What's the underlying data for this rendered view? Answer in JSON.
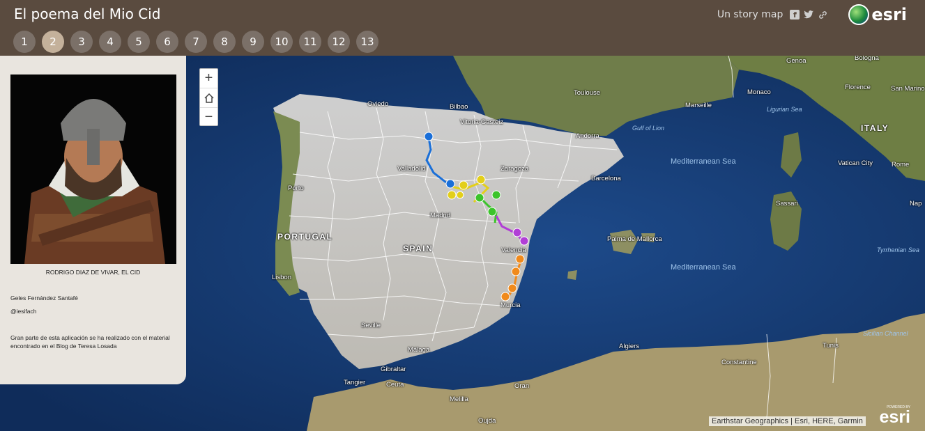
{
  "app": {
    "title": "El poema del Mio Cid"
  },
  "tabs": [
    "1",
    "2",
    "3",
    "4",
    "5",
    "6",
    "7",
    "8",
    "9",
    "10",
    "11",
    "12",
    "13"
  ],
  "active_tab": "2",
  "header": {
    "story_map_label": "Un story map",
    "brand": "esri"
  },
  "sidebar": {
    "caption": "RODRIGO DIAZ DE VIVAR, EL CID",
    "author": "Geles Fernández Santafé",
    "handle": "@iesifach",
    "credit": "Gran parte de esta aplicación se ha realizado con el material encontrado en el Blog de Teresa Losada"
  },
  "map": {
    "zoom_in": "+",
    "zoom_out": "−",
    "attribution": "Earthstar Geographics | Esri, HERE, Garmin",
    "powered_by": "POWERED BY",
    "powered_brand": "esri",
    "countries": [
      "PORTUGAL",
      "SPAIN",
      "ITALY"
    ],
    "seas": [
      "Mediterranean Sea",
      "Mediterranean Sea"
    ],
    "sea_features": [
      "Gulf of Lion",
      "Ligurian Sea",
      "Tyrrhenian Sea",
      "Sicilian Channel"
    ],
    "cities": [
      "Oviedo",
      "Bilbao",
      "Vitoria-Gasteiz",
      "Valladolid",
      "Zaragoza",
      "Barcelona",
      "Andorra",
      "Madrid",
      "Valencia",
      "Murcia",
      "Porto",
      "Lisbon",
      "Seville",
      "Málaga",
      "Gibraltar",
      "Tangier",
      "Ceuta",
      "Oran",
      "Melilla",
      "Oujda",
      "Algiers",
      "Constantine",
      "Tunis",
      "Toulouse",
      "Marseille",
      "Genoa",
      "Monaco",
      "Bologna",
      "Florence",
      "San Marino",
      "Vatican City",
      "Rome",
      "Sassari",
      "Palma de Mallorca",
      "Nap"
    ],
    "route_colors": {
      "blue": "#1a6fd8",
      "yellow": "#e3cf1a",
      "green": "#3cc42b",
      "purple": "#b13ed6",
      "orange": "#f08a1c"
    }
  }
}
